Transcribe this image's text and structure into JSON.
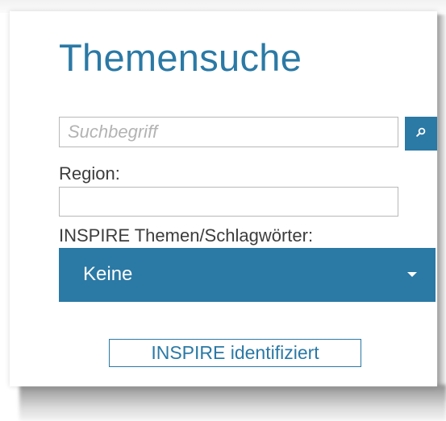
{
  "panel": {
    "title": "Themensuche"
  },
  "search": {
    "placeholder": "Suchbegriff",
    "value": "",
    "button_icon": "search-icon"
  },
  "region": {
    "label": "Region:",
    "value": ""
  },
  "inspire_topics": {
    "label": "INSPIRE Themen/Schlagwörter:",
    "selected": "Keine",
    "dropdown_icon": "caret-down-icon"
  },
  "inspire_button": {
    "label": "INSPIRE identifiziert"
  },
  "colors": {
    "accent": "#2b79a5",
    "label_text": "#3d3d3d",
    "placeholder": "#b3b3b3",
    "border": "#b8b8b8"
  }
}
